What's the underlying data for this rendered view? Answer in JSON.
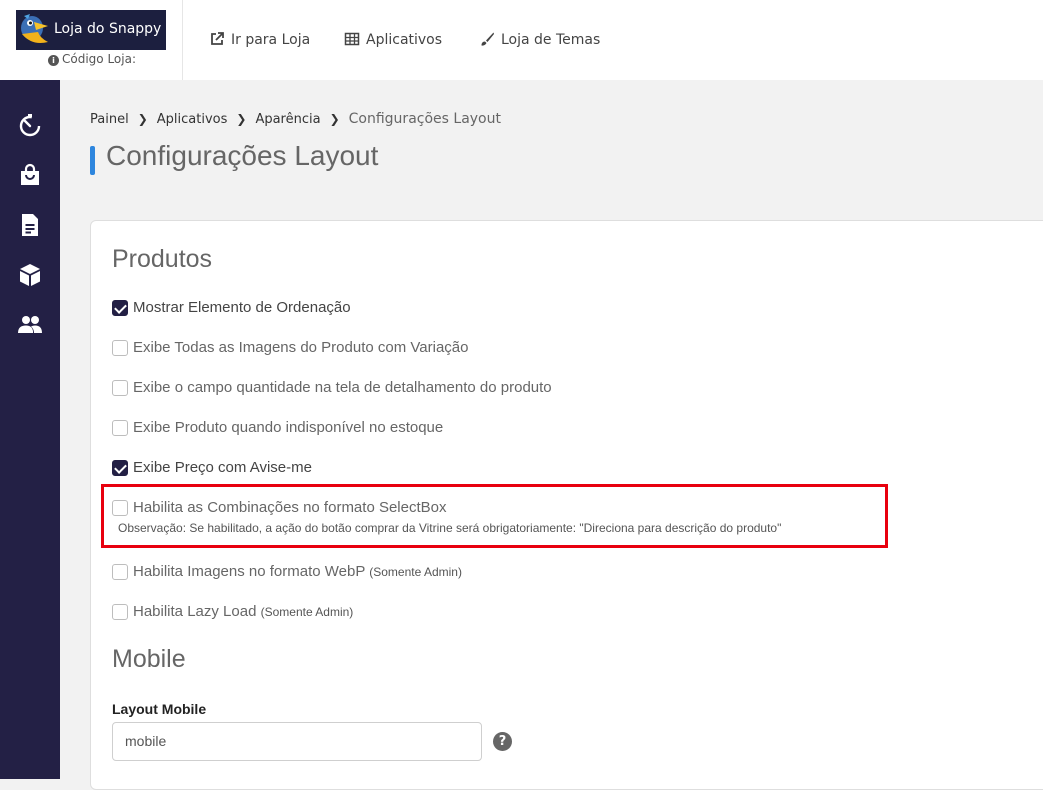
{
  "header": {
    "logo_text": "Loja do Snappy",
    "store_code_label": "Código Loja:",
    "nav": [
      {
        "label": "Ir para Loja",
        "icon": "external-link-icon"
      },
      {
        "label": "Aplicativos",
        "icon": "grid-icon"
      },
      {
        "label": "Loja de Temas",
        "icon": "brush-icon"
      }
    ]
  },
  "sidebar": {
    "items": [
      {
        "icon": "dashboard-timer-icon"
      },
      {
        "icon": "shopping-bag-icon"
      },
      {
        "icon": "document-icon"
      },
      {
        "icon": "box-icon"
      },
      {
        "icon": "users-icon"
      }
    ]
  },
  "breadcrumb": {
    "items": [
      "Painel",
      "Aplicativos",
      "Aparência"
    ],
    "current": "Configurações Layout"
  },
  "page_title": "Configurações Layout",
  "sections": {
    "produtos_title": "Produtos",
    "mobile_title": "Mobile"
  },
  "options": [
    {
      "label": "Mostrar Elemento de Ordenação",
      "checked": true,
      "note": ""
    },
    {
      "label": "Exibe Todas as Imagens do Produto com Variação",
      "checked": false,
      "note": ""
    },
    {
      "label": "Exibe o campo quantidade na tela de detalhamento do produto",
      "checked": false,
      "note": ""
    },
    {
      "label": "Exibe Produto quando indisponível no estoque",
      "checked": false,
      "note": ""
    },
    {
      "label": "Exibe Preço com Avise-me",
      "checked": true,
      "note": ""
    },
    {
      "label": "Habilita as Combinações no formato SelectBox",
      "checked": false,
      "note": ""
    },
    {
      "label": "Habilita Imagens no formato WebP",
      "checked": false,
      "note": "(Somente Admin)"
    },
    {
      "label": "Habilita Lazy Load",
      "checked": false,
      "note": "(Somente Admin)"
    }
  ],
  "selectbox_observation": "Observação: Se habilitado, a ação do botão comprar da Vitrine será obrigatoriamente: \"Direciona para descrição do produto\"",
  "layout_mobile": {
    "label": "Layout Mobile",
    "value": "mobile",
    "help_symbol": "?"
  },
  "colors": {
    "sidebar_bg": "#232045",
    "accent": "#2e86de",
    "highlight": "#e8000e"
  }
}
